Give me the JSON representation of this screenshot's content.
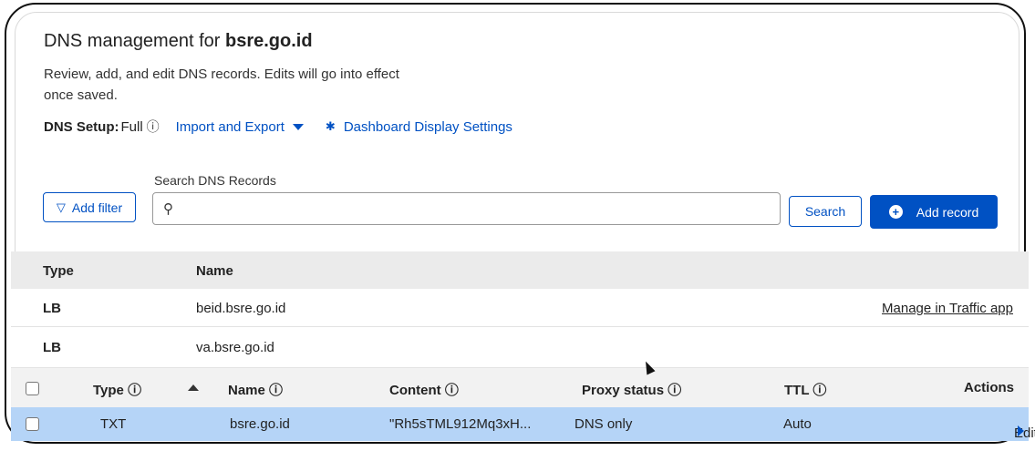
{
  "header": {
    "title_prefix": "DNS management for ",
    "domain": "bsre.go.id",
    "description": "Review, add, and edit DNS records. Edits will go into effect once saved.",
    "setup_label": "DNS Setup:",
    "setup_value": "Full",
    "info_symbol": "ⓘ",
    "import_export": "Import and Export",
    "dashboard_settings": "Dashboard Display Settings"
  },
  "search": {
    "label": "Search DNS Records",
    "placeholder": "",
    "button": "Search",
    "add_filter": "Add filter",
    "add_record": "Add record"
  },
  "lb_table": {
    "columns": [
      "Type",
      "Name"
    ],
    "rows": [
      {
        "type": "LB",
        "name": "beid.bsre.go.id",
        "action": "Manage in Traffic app"
      },
      {
        "type": "LB",
        "name": "va.bsre.go.id"
      }
    ]
  },
  "records_table": {
    "columns": [
      "Type ⓘ",
      "Name ⓘ",
      "Content ⓘ",
      "Proxy status ⓘ",
      "TTL ⓘ",
      "Actions"
    ],
    "rows": [
      {
        "type": "TXT",
        "name": "bsre.go.id",
        "content": "\"Rh5sTML912Mq3xH...",
        "proxy": "DNS only",
        "ttl": "Auto",
        "action": "Edit"
      }
    ]
  },
  "colors": {
    "accent": "#0051c3",
    "selected_row": "#b5d4f7",
    "header_bg": "#ebebeb"
  },
  "icons": [
    "info-icon",
    "caret-down-icon",
    "gear-icon",
    "funnel-icon",
    "search-icon",
    "plus-icon",
    "sort-up-icon",
    "caret-right-icon",
    "mouse-cursor"
  ]
}
